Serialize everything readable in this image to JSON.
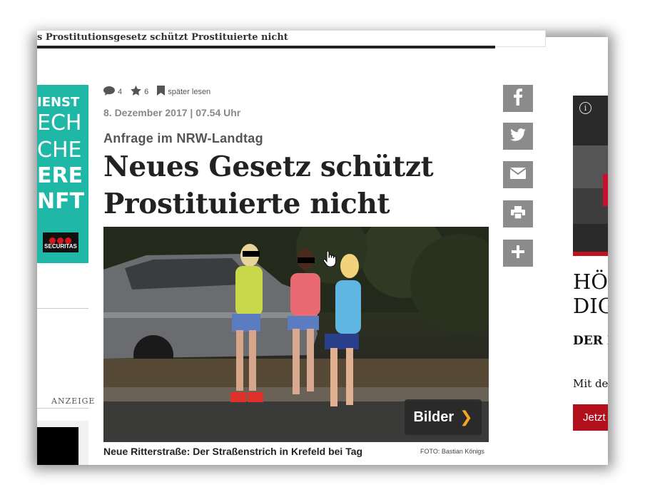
{
  "sticky_bar": {
    "title": "s Prostitutionsgesetz schützt Prostituierte nicht"
  },
  "ad_left": {
    "lines": [
      "IENST",
      "ECH",
      "CHE",
      "ERE",
      "NFT"
    ],
    "logo_text": "SECURITAS",
    "label": "ANZEIGE"
  },
  "article": {
    "comments_count": "4",
    "favorites_count": "6",
    "read_later": "später lesen",
    "date": "8. Dezember 2017 | 07.54 Uhr",
    "kicker": "Anfrage im NRW-Landtag",
    "headline": "Neues Gesetz schützt Prostituierte nicht",
    "gallery_button": "Bilder",
    "caption": "Neue Ritterstraße: Der Straßenstrich in Krefeld bei Tag",
    "photo_credit": "FOTO: Bastian Königs"
  },
  "share": {
    "icons": [
      "facebook-icon",
      "twitter-icon",
      "mail-icon",
      "print-icon",
      "plus-icon"
    ]
  },
  "right_column": {
    "headline_line1": "HÖ",
    "headline_line2": "DIG",
    "subheadline": "DER I",
    "text": "Mit der",
    "button": "Jetzt"
  },
  "colors": {
    "ad_teal": "#1fb7a6",
    "share_gray": "#8c8c8c",
    "cta_red": "#b3101e",
    "gallery_chevron": "#f5a623"
  }
}
